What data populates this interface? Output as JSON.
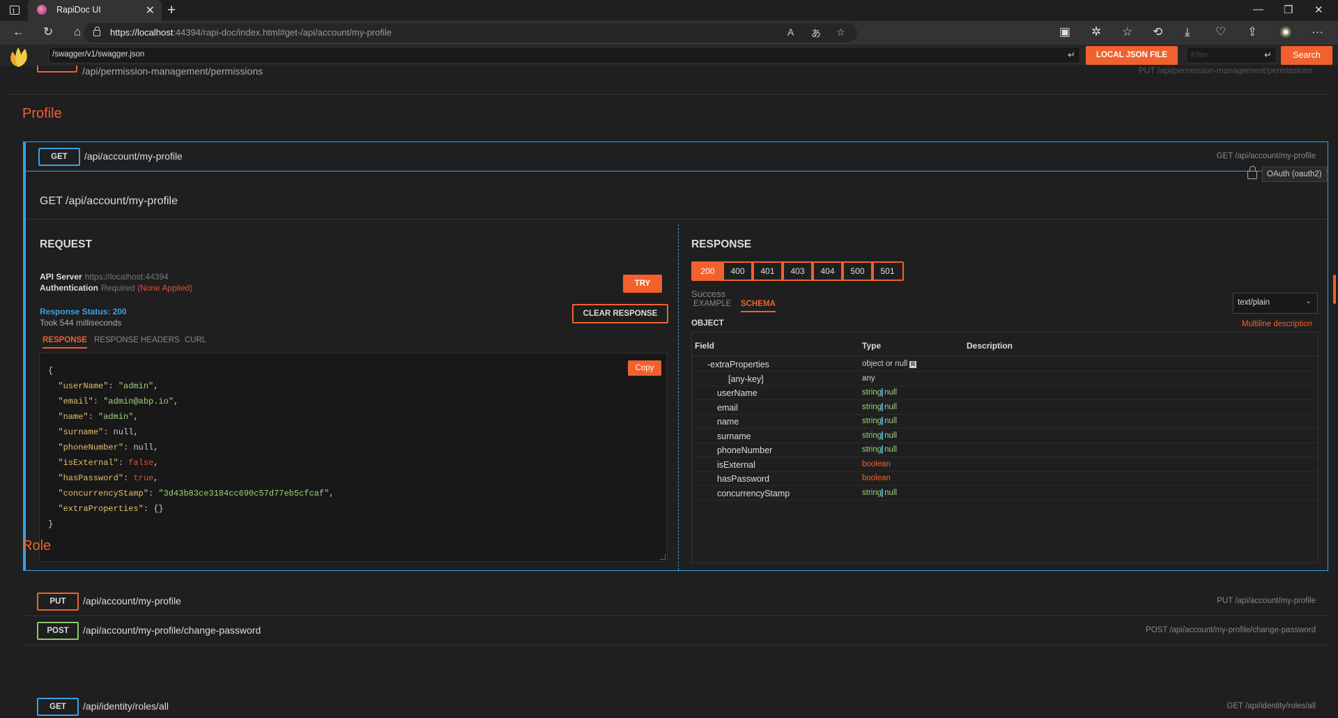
{
  "browser": {
    "tab_title": "RapiDoc UI",
    "url_host": "https://localhost",
    "url_rest": ":44394/rapi-doc/index.html#get-/api/account/my-profile"
  },
  "header": {
    "spec_url": "/swagger/v1/swagger.json",
    "local_json_label": "LOCAL JSON FILE",
    "filter_placeholder": "Filter",
    "search_label": "Search"
  },
  "partial_op": {
    "path": "/api/permission-management/permissions",
    "summary": "PUT /api/permission-management/permissions"
  },
  "sections": {
    "profile": "Profile",
    "role": "Role"
  },
  "expanded_op": {
    "method": "GET",
    "path": "/api/account/my-profile",
    "summary": "GET /api/account/my-profile",
    "title": "GET /api/account/my-profile",
    "security": "OAuth (oauth2)",
    "request": {
      "heading": "REQUEST",
      "api_server_label": "API Server",
      "api_server_value": "https://localhost:44394",
      "auth_label": "Authentication",
      "auth_required": "Required",
      "auth_status": "(None Applied)",
      "try_label": "TRY",
      "response_status": "Response Status: 200",
      "took": "Took 544 milliseconds",
      "clear_label": "CLEAR RESPONSE",
      "tabs": [
        "RESPONSE",
        "RESPONSE HEADERS",
        "CURL"
      ],
      "copy_label": "Copy",
      "json": [
        {
          "key": "\"userName\"",
          "val": "\"admin\"",
          "type": "s",
          "comma": ","
        },
        {
          "key": "\"email\"",
          "val": "\"admin@abp.io\"",
          "type": "s",
          "comma": ","
        },
        {
          "key": "\"name\"",
          "val": "\"admin\"",
          "type": "s",
          "comma": ","
        },
        {
          "key": "\"surname\"",
          "val": "null",
          "type": "n",
          "comma": ","
        },
        {
          "key": "\"phoneNumber\"",
          "val": "null",
          "type": "n",
          "comma": ","
        },
        {
          "key": "\"isExternal\"",
          "val": "false",
          "type": "f",
          "comma": ","
        },
        {
          "key": "\"hasPassword\"",
          "val": "true",
          "type": "f",
          "comma": ","
        },
        {
          "key": "\"concurrencyStamp\"",
          "val": "\"3d43b83ce3184cc690c57d77eb5cfcaf\"",
          "type": "s",
          "comma": ","
        },
        {
          "key": "\"extraProperties\"",
          "val": "{}",
          "type": "n",
          "comma": ""
        }
      ]
    },
    "response": {
      "heading": "RESPONSE",
      "codes": [
        "200",
        "400",
        "401",
        "403",
        "404",
        "500",
        "501"
      ],
      "active_code": "200",
      "description": "Success",
      "tabs": [
        "EXAMPLE",
        "SCHEMA"
      ],
      "mime": "text/plain",
      "object_label": "OBJECT",
      "multiline_label": "Multiline description",
      "headers": [
        "Field",
        "Type",
        "Description"
      ],
      "fields": [
        {
          "name": "-extraProperties",
          "type": "object or null",
          "kind": "obj",
          "indent": 1
        },
        {
          "name": "[any-key]",
          "type": "any",
          "kind": "any",
          "indent": 2
        },
        {
          "name": "userName",
          "type": "string",
          "kind": "strnull",
          "indent": 0
        },
        {
          "name": "email",
          "type": "string",
          "kind": "strnull",
          "indent": 0
        },
        {
          "name": "name",
          "type": "string",
          "kind": "strnull",
          "indent": 0
        },
        {
          "name": "surname",
          "type": "string",
          "kind": "strnull",
          "indent": 0
        },
        {
          "name": "phoneNumber",
          "type": "string",
          "kind": "strnull",
          "indent": 0
        },
        {
          "name": "isExternal",
          "type": "boolean",
          "kind": "bool",
          "indent": 0
        },
        {
          "name": "hasPassword",
          "type": "boolean",
          "kind": "bool",
          "indent": 0
        },
        {
          "name": "concurrencyStamp",
          "type": "string",
          "kind": "strnull",
          "indent": 0
        }
      ],
      "null_label": "null",
      "required_marker": "R"
    }
  },
  "other_ops": [
    {
      "method": "PUT",
      "path": "/api/account/my-profile",
      "summary": "PUT /api/account/my-profile",
      "color": "#f0612d"
    },
    {
      "method": "POST",
      "path": "/api/account/my-profile/change-password",
      "summary": "POST /api/account/my-profile/change-password",
      "color": "#8bcb6e"
    }
  ],
  "role_ops": [
    {
      "method": "GET",
      "path": "/api/identity/roles/all",
      "summary": "GET /api/identity/roles/all",
      "color": "#39a2e5"
    }
  ]
}
